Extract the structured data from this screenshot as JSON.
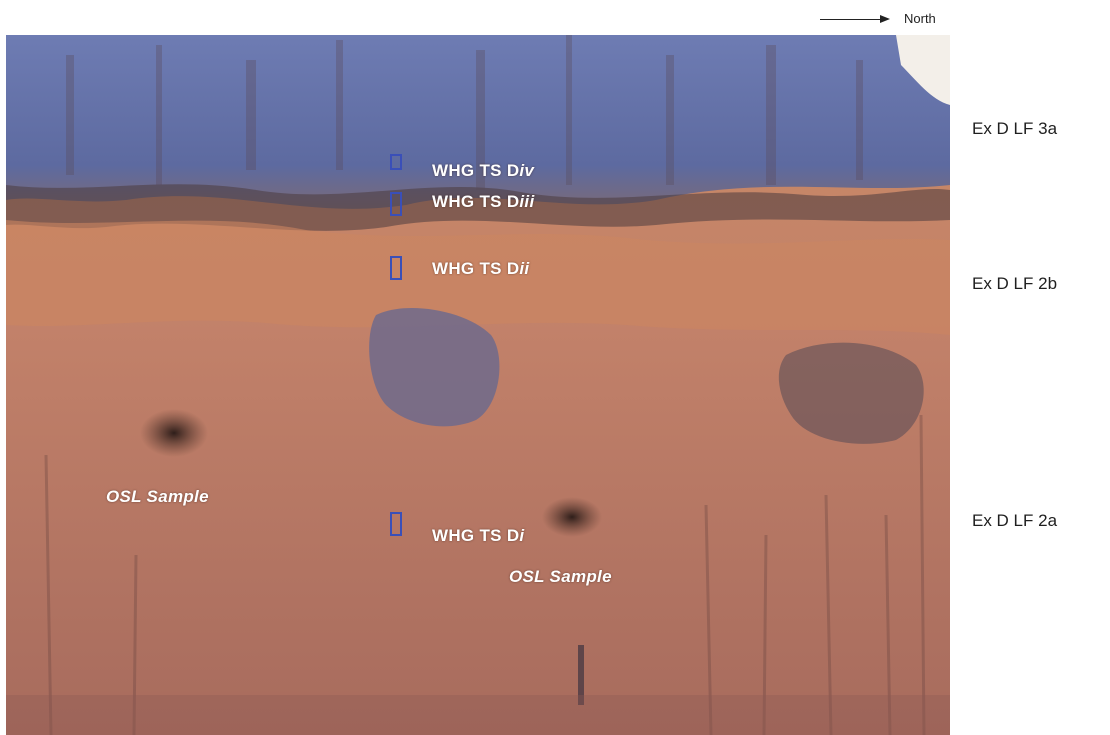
{
  "north_label": "North",
  "labels": {
    "d_iv": {
      "prefix": "WHG TS D",
      "suffix": "iv"
    },
    "d_iii": {
      "prefix": "WHG TS D",
      "suffix": "iii"
    },
    "d_ii": {
      "prefix": "WHG TS D",
      "suffix": "ii"
    },
    "d_i": {
      "prefix": "WHG TS D",
      "suffix": "i"
    },
    "osl_left": "OSL Sample",
    "osl_right": "OSL Sample"
  },
  "units": {
    "lf3a": "Ex D LF 3a",
    "lf2b": "Ex D LF 2b",
    "lf2a": "Ex D LF 2a"
  },
  "colors": {
    "sediment": "#c07e63",
    "blue_face": "#6b79ad",
    "marker_blue": "#3a4fb8"
  }
}
